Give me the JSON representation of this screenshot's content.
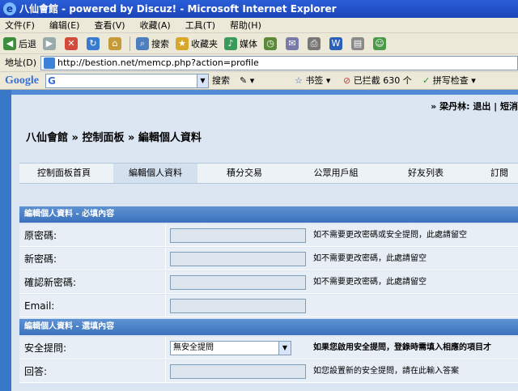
{
  "window": {
    "title": "八仙會館 - powered by Discuz! - Microsoft Internet Explorer"
  },
  "menu": [
    "文件(F)",
    "编辑(E)",
    "查看(V)",
    "收藏(A)",
    "工具(T)",
    "帮助(H)"
  ],
  "toolbar": {
    "back": "后退",
    "search": "搜索",
    "favorites": "收藏夹",
    "media": "媒体"
  },
  "address": {
    "label": "地址(D)",
    "url": "http://bestion.net/memcp.php?action=profile"
  },
  "googlebar": {
    "logo": "Google",
    "g": "G",
    "search": "搜索",
    "bookmarks": "书签",
    "blocked": "已拦截 630 个",
    "spellcheck": "拼写检查"
  },
  "page": {
    "userline": "» 梁丹林: 退出 | 短消",
    "breadcrumb": "八仙會館 » 控制面板 » 編輯個人資料",
    "tabs": [
      "控制面板首頁",
      "編輯個人資料",
      "積分交易",
      "公眾用戶組",
      "好友列表",
      "訂閱"
    ],
    "required_section": "編輯個人資料 - 必填內容",
    "optional_section": "編輯個人資料 - 選填內容",
    "rows": [
      {
        "label": "原密碼:",
        "hint": "如不需要更改密碼或安全提問，此處請留空"
      },
      {
        "label": "新密碼:",
        "hint": "如不需要更改密碼，此處請留空"
      },
      {
        "label": "確認新密碼:",
        "hint": "如不需要更改密碼，此處請留空"
      },
      {
        "label": "Email:",
        "hint": ""
      }
    ],
    "optional_rows": [
      {
        "label": "安全提問:",
        "select": "無安全提問",
        "hint": "如果您啟用安全提問，登錄時需填入相應的項目才"
      },
      {
        "label": "回答:",
        "hint": "如您設置新的安全提問，請在此輸入答案"
      }
    ]
  },
  "colors": {
    "titlebar": "#2a5fd8",
    "section_header": "#4a82c9",
    "content_bg": "#dbe6f2",
    "row_bg": "#e7eef6"
  }
}
